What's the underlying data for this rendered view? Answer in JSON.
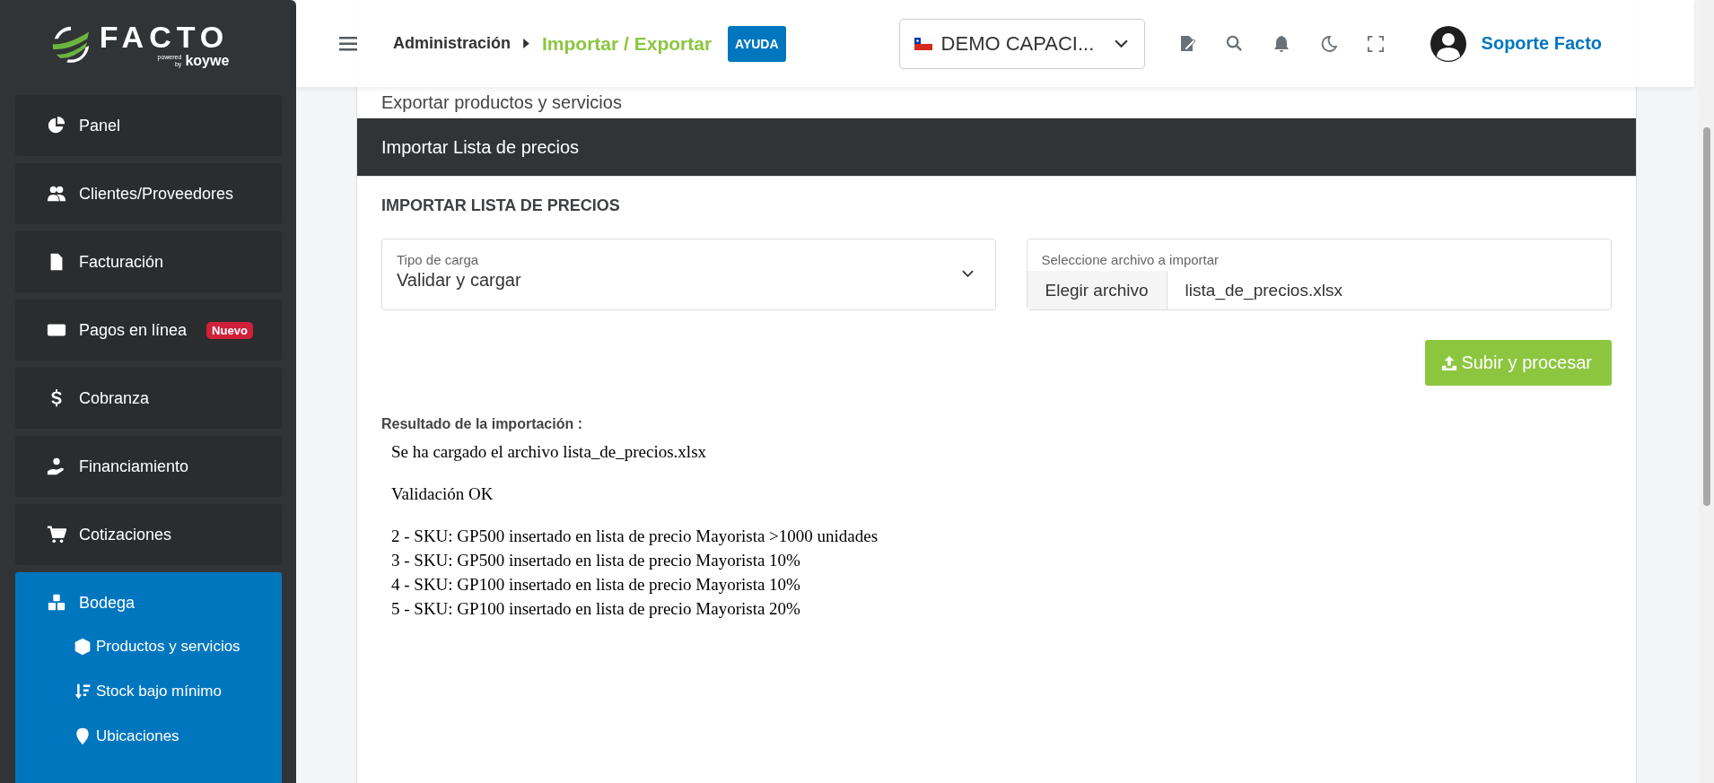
{
  "sidebar": {
    "logo": {
      "name": "FACTO",
      "powered": "powered by",
      "brand": "koywe"
    },
    "items": [
      {
        "label": "Panel",
        "selected": false
      },
      {
        "label": "Clientes/Proveedores",
        "selected": false
      },
      {
        "label": "Facturación",
        "selected": false
      },
      {
        "label": "Pagos en línea",
        "selected": false,
        "badge": "Nuevo"
      },
      {
        "label": "Cobranza",
        "selected": false
      },
      {
        "label": "Financiamiento",
        "selected": false
      },
      {
        "label": "Cotizaciones",
        "selected": false
      },
      {
        "label": "Bodega",
        "selected": true,
        "expanded": true,
        "children": [
          {
            "label": "Productos y servicios"
          },
          {
            "label": "Stock bajo mínimo"
          },
          {
            "label": "Ubicaciones"
          }
        ]
      }
    ]
  },
  "header": {
    "breadcrumb": [
      "Administración",
      "Importar / Exportar"
    ],
    "help": "AYUDA",
    "company": "DEMO CAPACI...",
    "user": "Soporte Facto"
  },
  "accordion": [
    {
      "title": "Exportar productos y servicios",
      "expanded": false
    },
    {
      "title": "Importar Lista de precios",
      "expanded": true
    }
  ],
  "import": {
    "title": "IMPORTAR LISTA DE PRECIOS",
    "load_type": {
      "label": "Tipo de carga",
      "value": "Validar y cargar"
    },
    "file": {
      "label": "Seleccione archivo a importar",
      "button": "Elegir archivo",
      "value": "lista_de_precios.xlsx"
    },
    "submit": "Subir y procesar",
    "result_label": "Resultado de la importación :",
    "result_blocks": [
      [
        "Se ha cargado el archivo lista_de_precios.xlsx"
      ],
      [
        "Validación OK"
      ],
      [
        "2 - SKU: GP500 insertado en lista de precio Mayorista >1000 unidades",
        "3 - SKU: GP500 insertado en lista de precio Mayorista 10%",
        "4 - SKU: GP100 insertado en lista de precio Mayorista 10%",
        "5 - SKU: GP100 insertado en lista de precio Mayorista 20%"
      ]
    ]
  }
}
